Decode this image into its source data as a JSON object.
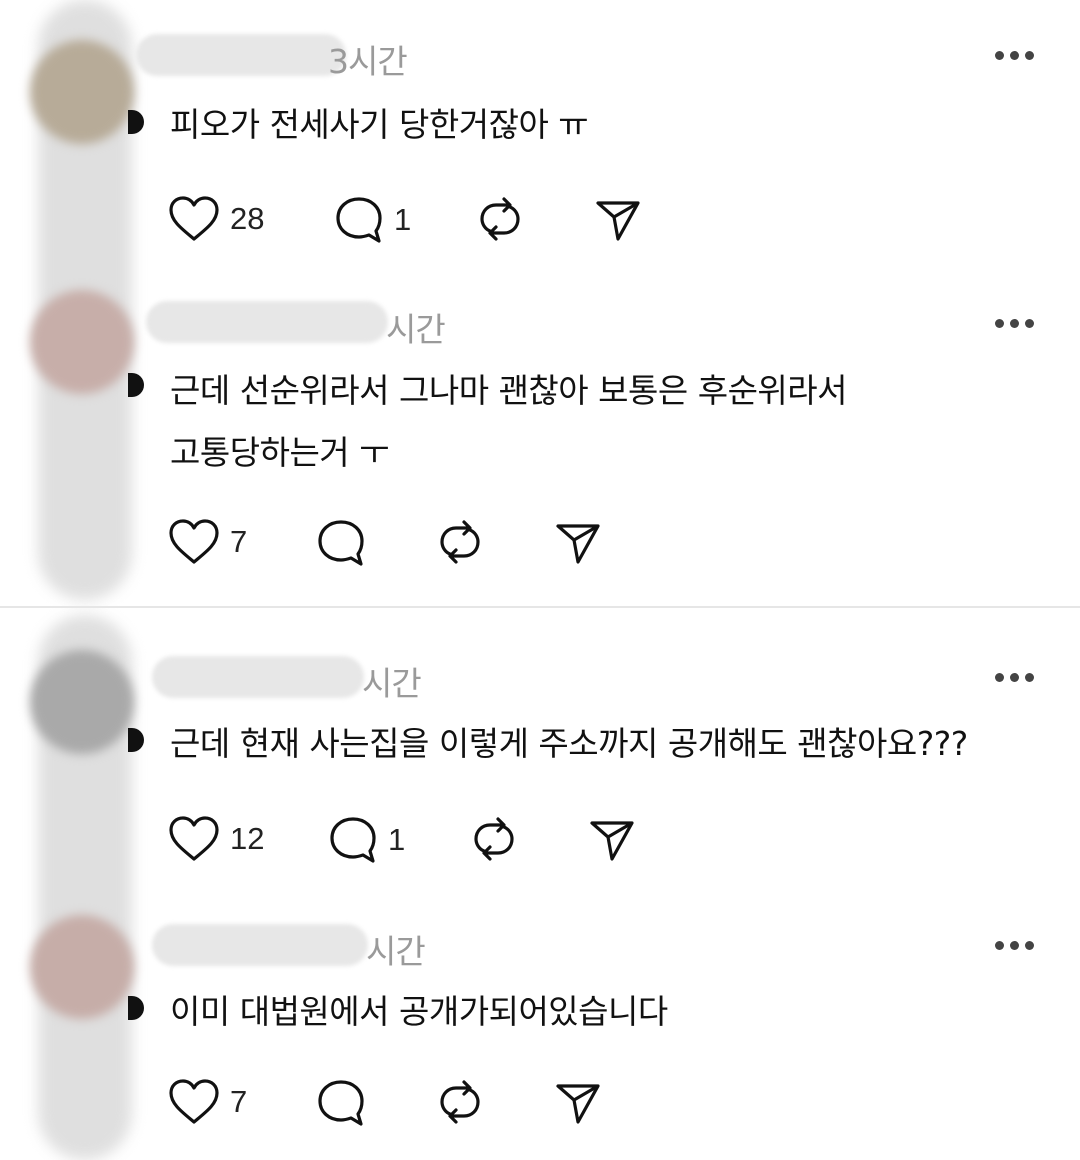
{
  "posts": [
    {
      "time": "3시간",
      "text": "피오가 전세사기 당한거잖아 ㅠ",
      "likes": "28",
      "replies": "1"
    },
    {
      "time": "시간",
      "text": "근데 선순위라서 그나마 괜찮아 보통은 후순위라서\n고통당하는거 ㅜ",
      "likes": "7",
      "replies": ""
    },
    {
      "time": "시간",
      "text": "근데 현재 사는집을 이렇게 주소까지 공개해도 괜찮아요???",
      "likes": "12",
      "replies": "1"
    },
    {
      "time": "시간",
      "text": "이미 대법원에서 공개가되어있습니다",
      "likes": "7",
      "replies": ""
    }
  ],
  "icons": {
    "like": "heart-icon",
    "reply": "comment-bubble-icon",
    "repost": "repost-icon",
    "share": "send-icon",
    "more": "more-dots-icon"
  },
  "colors": {
    "text": "#111111",
    "muted": "#9a9a9a",
    "divider": "#e6e6e6"
  }
}
